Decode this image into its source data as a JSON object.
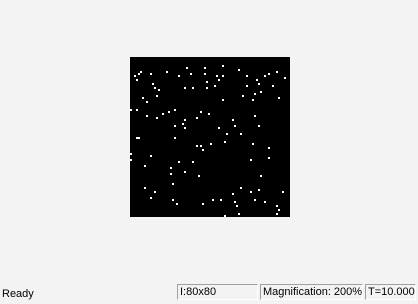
{
  "status": {
    "ready_text": "Ready",
    "size_text": "I:80x80",
    "magnification_text": "Magnification: 200%",
    "time_text": "T=10.000"
  },
  "simulation": {
    "grid_cols": 80,
    "grid_rows": 80,
    "background_color": "#000000",
    "cell_color": "#ffffff",
    "live_cells": [
      [
        28,
        5
      ],
      [
        5,
        7
      ],
      [
        10,
        8
      ],
      [
        18,
        7
      ],
      [
        24,
        9
      ],
      [
        30,
        8
      ],
      [
        37,
        8
      ],
      [
        43,
        9
      ],
      [
        46,
        9
      ],
      [
        2,
        9
      ],
      [
        3,
        11
      ],
      [
        4,
        8
      ],
      [
        11,
        13
      ],
      [
        12,
        15
      ],
      [
        14,
        16
      ],
      [
        27,
        15
      ],
      [
        31,
        15
      ],
      [
        38,
        12
      ],
      [
        44,
        11
      ],
      [
        38,
        15
      ],
      [
        42,
        14
      ],
      [
        46,
        21
      ],
      [
        13,
        19
      ],
      [
        6,
        20
      ],
      [
        8,
        22
      ],
      [
        3,
        26
      ],
      [
        8,
        29
      ],
      [
        13,
        30
      ],
      [
        16,
        28
      ],
      [
        19,
        27
      ],
      [
        22,
        26
      ],
      [
        35,
        27
      ],
      [
        39,
        28
      ],
      [
        26,
        33
      ],
      [
        27,
        31
      ],
      [
        33,
        30
      ],
      [
        44,
        35
      ],
      [
        48,
        38
      ],
      [
        40,
        43
      ],
      [
        27,
        35
      ],
      [
        31,
        52
      ],
      [
        24,
        52
      ],
      [
        10,
        49
      ],
      [
        20,
        55
      ],
      [
        27,
        57
      ],
      [
        21,
        63
      ],
      [
        34,
        59
      ],
      [
        7,
        65
      ],
      [
        12,
        67
      ],
      [
        10,
        70
      ],
      [
        21,
        71
      ],
      [
        23,
        73
      ],
      [
        36,
        73
      ],
      [
        41,
        71
      ],
      [
        45,
        71
      ],
      [
        51,
        68
      ],
      [
        52,
        72
      ],
      [
        62,
        71
      ],
      [
        67,
        72
      ],
      [
        73,
        74
      ],
      [
        74,
        76
      ],
      [
        73,
        78
      ],
      [
        76,
        67
      ],
      [
        65,
        59
      ],
      [
        69,
        50
      ],
      [
        69,
        45
      ],
      [
        60,
        51
      ],
      [
        61,
        43
      ],
      [
        52,
        34
      ],
      [
        51,
        31
      ],
      [
        62,
        29
      ],
      [
        55,
        38
      ],
      [
        64,
        34
      ],
      [
        71,
        14
      ],
      [
        65,
        17
      ],
      [
        62,
        18
      ],
      [
        61,
        21
      ],
      [
        58,
        14
      ],
      [
        56,
        19
      ],
      [
        58,
        9
      ],
      [
        63,
        11
      ],
      [
        64,
        13
      ],
      [
        69,
        8
      ],
      [
        67,
        9
      ],
      [
        73,
        7
      ],
      [
        74,
        20
      ],
      [
        77,
        10
      ],
      [
        54,
        6
      ],
      [
        46,
        4
      ],
      [
        37,
        5
      ],
      [
        0,
        26
      ],
      [
        0,
        51
      ],
      [
        7,
        54
      ],
      [
        3,
        40
      ],
      [
        4,
        40
      ],
      [
        33,
        44
      ],
      [
        35,
        44
      ],
      [
        36,
        46
      ],
      [
        22,
        34
      ],
      [
        22,
        40
      ],
      [
        20,
        58
      ],
      [
        0,
        48
      ],
      [
        53,
        74
      ],
      [
        54,
        78
      ],
      [
        47,
        79
      ],
      [
        47,
        42
      ],
      [
        55,
        65
      ],
      [
        60,
        67
      ],
      [
        64,
        66
      ]
    ]
  }
}
